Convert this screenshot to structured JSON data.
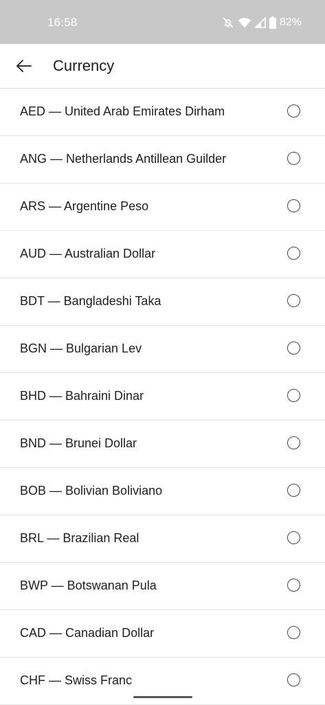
{
  "status_bar": {
    "time": "16:58",
    "battery": "82%",
    "icons": [
      "notifications-muted-icon",
      "wifi-icon",
      "signal-icon",
      "battery-icon"
    ]
  },
  "header": {
    "back_icon": "arrow-left-icon",
    "title": "Currency"
  },
  "currencies": [
    {
      "label": "AED — United Arab Emirates Dirham",
      "selected": false
    },
    {
      "label": "ANG — Netherlands Antillean Guilder",
      "selected": false
    },
    {
      "label": "ARS — Argentine Peso",
      "selected": false
    },
    {
      "label": "AUD — Australian Dollar",
      "selected": false
    },
    {
      "label": "BDT — Bangladeshi Taka",
      "selected": false
    },
    {
      "label": "BGN — Bulgarian Lev",
      "selected": false
    },
    {
      "label": "BHD — Bahraini Dinar",
      "selected": false
    },
    {
      "label": "BND — Brunei Dollar",
      "selected": false
    },
    {
      "label": "BOB — Bolivian Boliviano",
      "selected": false
    },
    {
      "label": "BRL — Brazilian Real",
      "selected": false
    },
    {
      "label": "BWP — Botswanan Pula",
      "selected": false
    },
    {
      "label": "CAD — Canadian Dollar",
      "selected": false
    },
    {
      "label": "CHF — Swiss Franc",
      "selected": false
    }
  ],
  "colors": {
    "status_bar_bg": "#c8c8c8",
    "text": "#202020",
    "divider": "#e4e4e4"
  }
}
